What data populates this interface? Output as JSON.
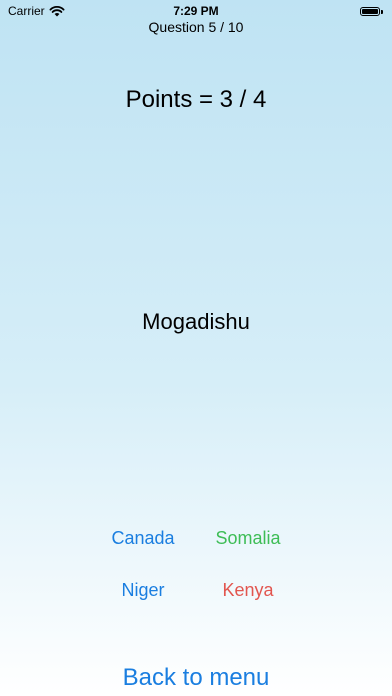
{
  "status_bar": {
    "carrier": "Carrier",
    "time": "7:29 PM",
    "wifi_icon": "wifi-icon",
    "battery_icon": "battery-icon"
  },
  "quiz": {
    "question_counter": "Question 5 / 10",
    "points": "Points = 3 / 4",
    "capital": "Mogadishu"
  },
  "answers": [
    {
      "label": "Canada",
      "color": "#1a7ee0"
    },
    {
      "label": "Somalia",
      "color": "#3ebd56"
    },
    {
      "label": "Niger",
      "color": "#1a7ee0"
    },
    {
      "label": "Kenya",
      "color": "#e2564f"
    }
  ],
  "footer": {
    "back_label": "Back to menu",
    "back_color": "#1a7ee0"
  }
}
